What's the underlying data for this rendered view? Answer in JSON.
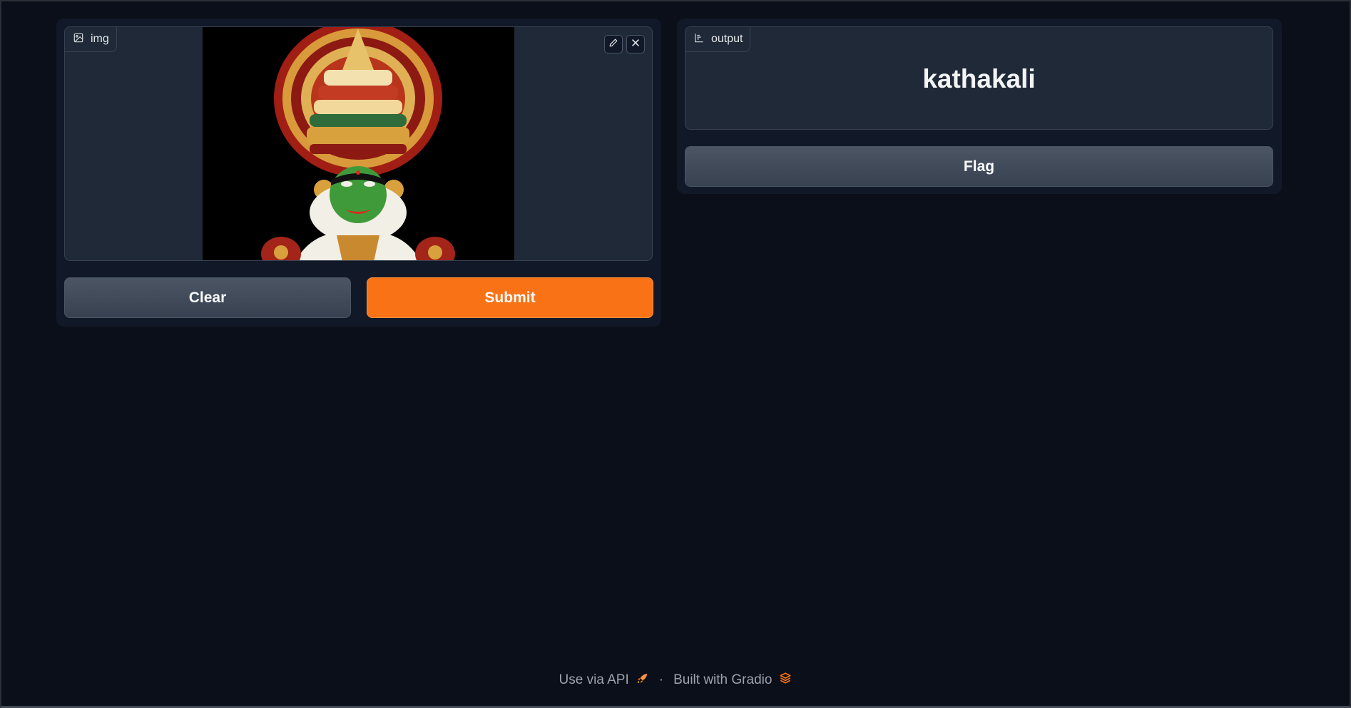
{
  "input": {
    "label": "img",
    "label_icon": "image-icon",
    "photo_description_icon": "kathakali-dancer-image",
    "edit_icon": "pencil-icon",
    "close_icon": "close-icon"
  },
  "output": {
    "label": "output",
    "label_icon": "bar-chart-icon",
    "value": "kathakali"
  },
  "buttons": {
    "clear": "Clear",
    "submit": "Submit",
    "flag": "Flag"
  },
  "footer": {
    "api": "Use via API",
    "separator": "·",
    "built": "Built with Gradio",
    "api_icon": "rocket-icon",
    "gradio_icon": "gradio-logo-icon"
  },
  "colors": {
    "background": "#0b0f19",
    "panel": "#111827",
    "block": "#1f2937",
    "primary": "#f97316",
    "secondary": "#4b5563"
  }
}
